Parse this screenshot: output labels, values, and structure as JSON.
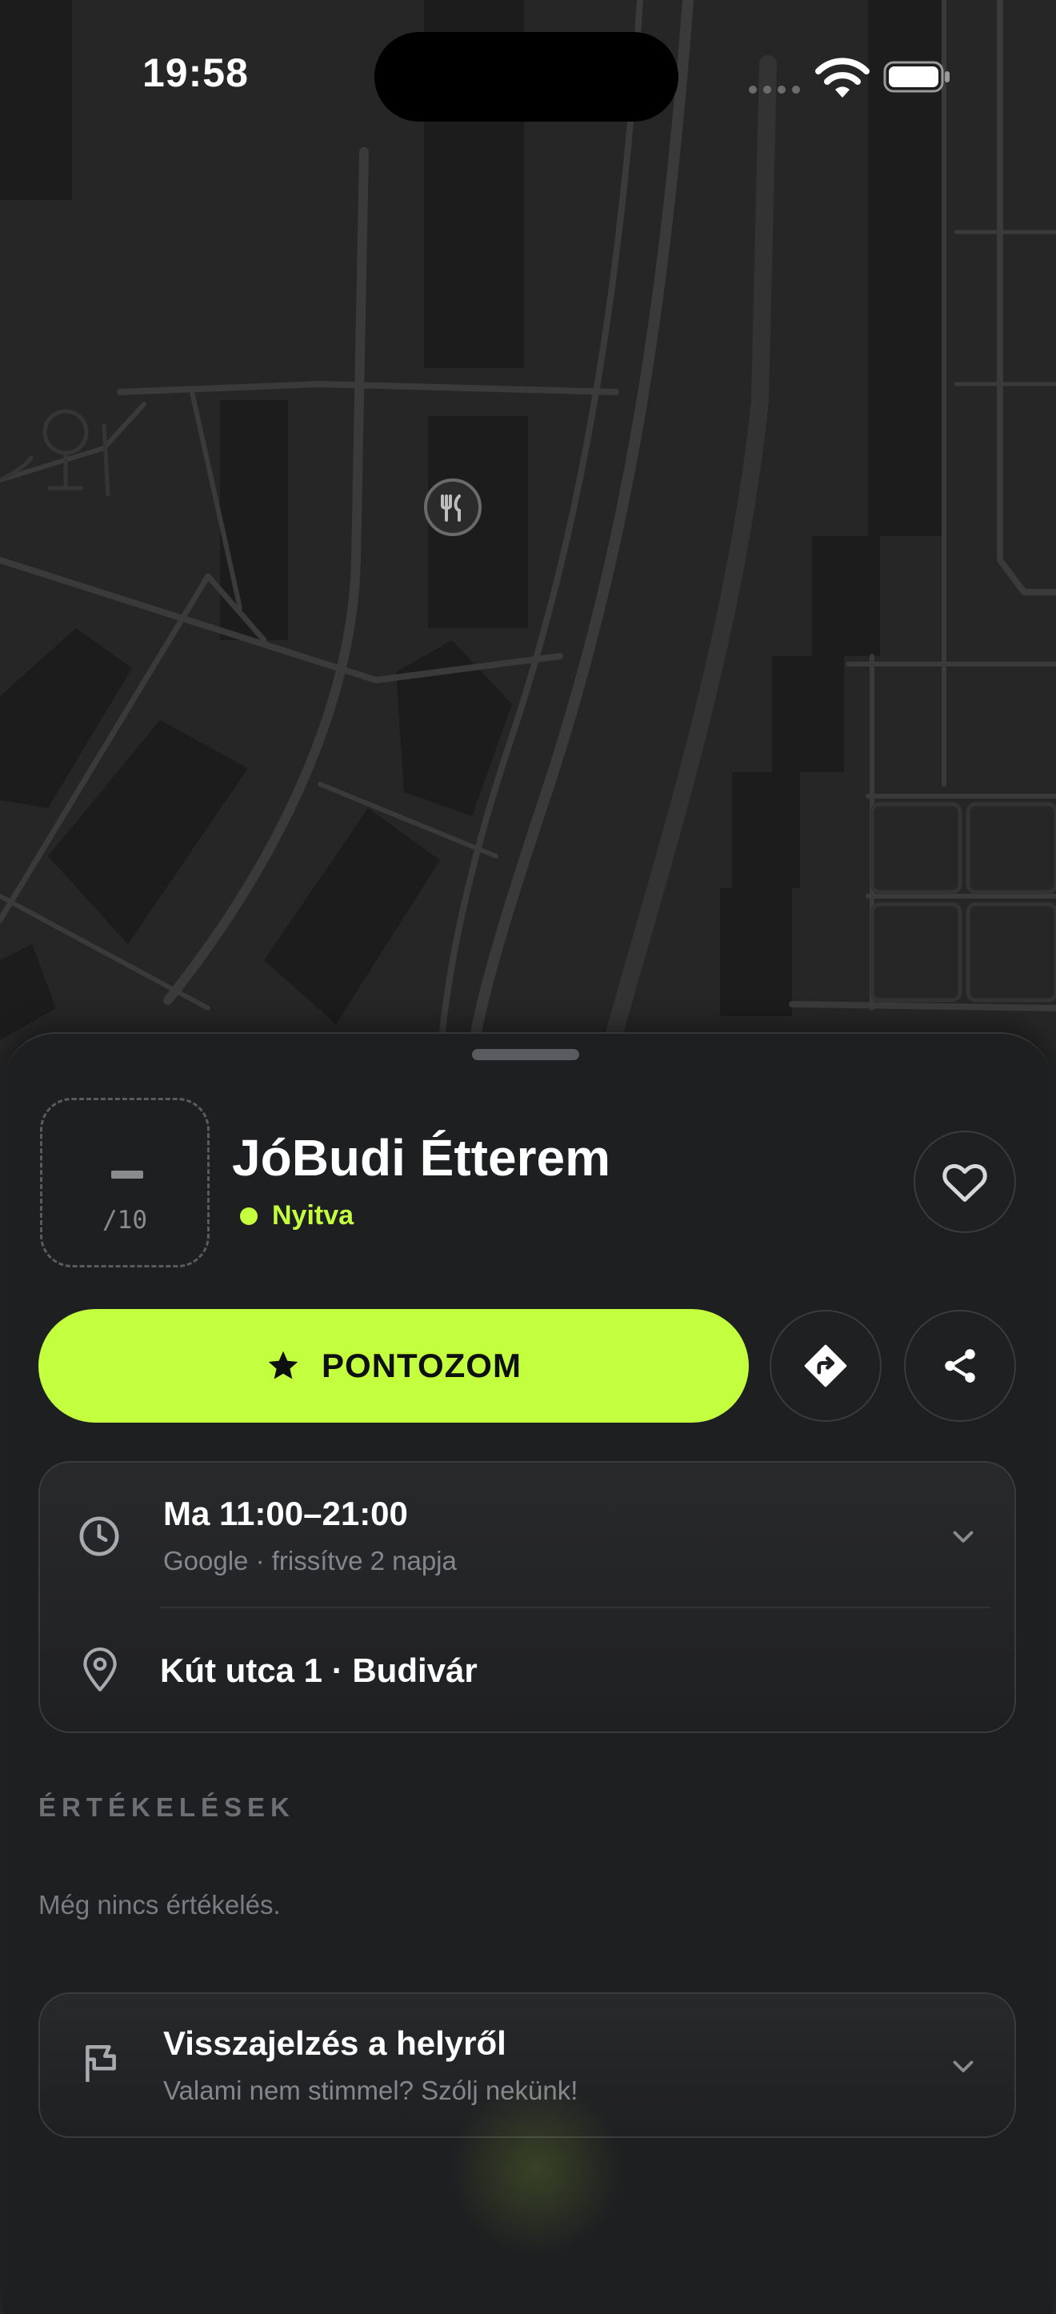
{
  "status_bar": {
    "time": "19:58"
  },
  "map": {
    "marker_icon": "fork-knife-icon"
  },
  "place": {
    "score_value": "–",
    "score_scale": "/10",
    "name": "JóBudi Étterem",
    "status": "Nyitva",
    "status_color": "#c4ff3f"
  },
  "actions": {
    "rate_label": "PONTOZOM",
    "accent": "#c4ff3f"
  },
  "info": {
    "hours_main": "Ma 11:00–21:00",
    "hours_sub": "Google · frissítve 2 napja",
    "address": "Kút utca 1 · Budivár"
  },
  "reviews": {
    "section_title": "ÉRTÉKELÉSEK",
    "empty_text": "Még nincs értékelés."
  },
  "report": {
    "title": "Visszajelzés a helyről",
    "subtitle": "Valami nem stimmel? Szólj nekünk!"
  }
}
